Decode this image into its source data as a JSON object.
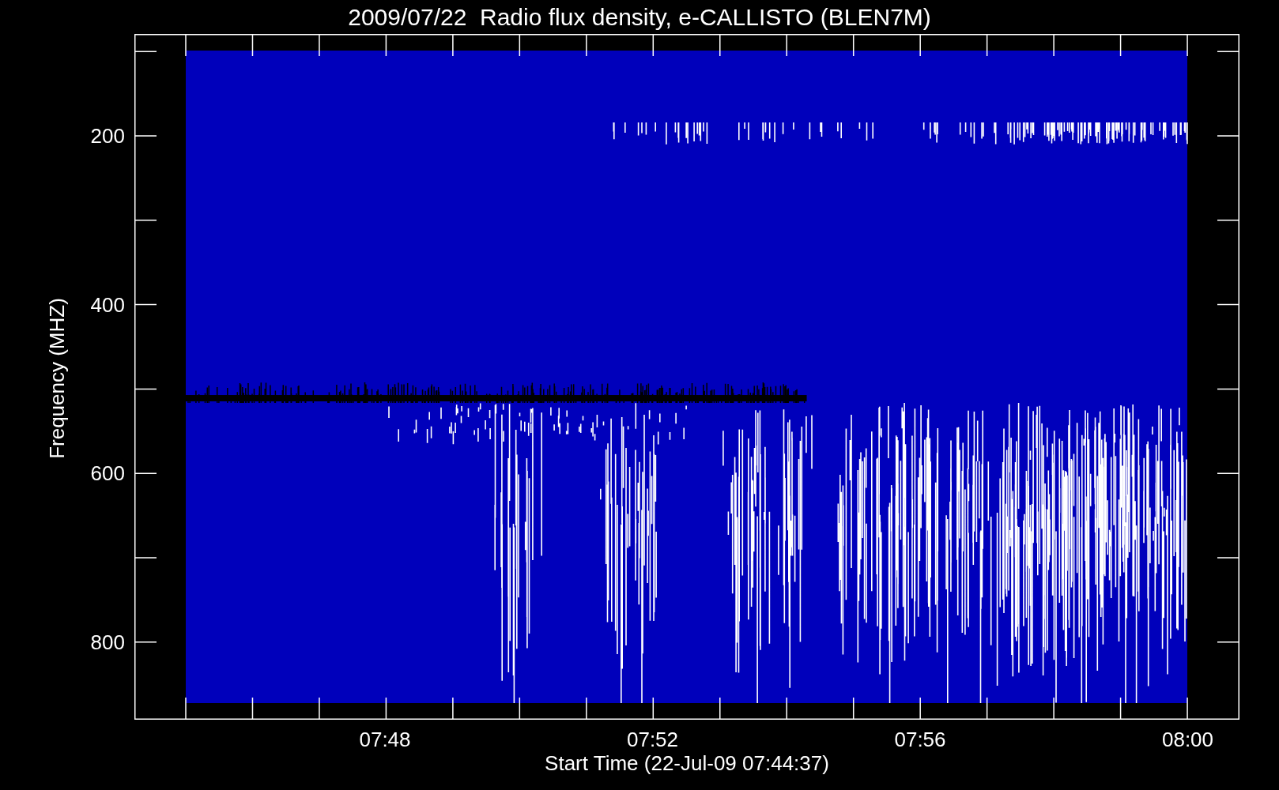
{
  "title": "2009/07/22  Radio flux density, e-CALLISTO (BLEN7M)",
  "y_axis": {
    "label": "Frequency (MHZ)",
    "ticks": [
      "200",
      "400",
      "600",
      "800"
    ]
  },
  "x_axis": {
    "label": "Start Time (22-Jul-09 07:44:37)",
    "ticks": [
      "07:48",
      "07:52",
      "07:56",
      "08:00"
    ]
  }
}
